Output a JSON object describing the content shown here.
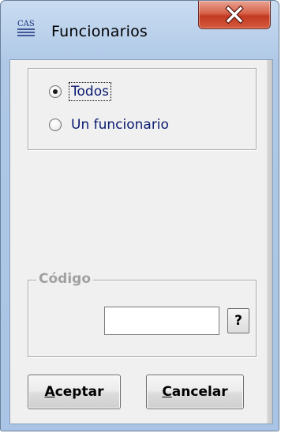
{
  "window": {
    "title": "Funcionarios",
    "app_icon_text": "CAS"
  },
  "options": {
    "todos_label": "Todos",
    "un_funcionario_label": "Un funcionario",
    "selected": "Todos"
  },
  "codigo": {
    "legend": "Código",
    "value": "",
    "help_label": "?"
  },
  "buttons": {
    "aceptar_mnemonic": "A",
    "aceptar_rest": "ceptar",
    "cancelar_mnemonic": "C",
    "cancelar_rest": "ancelar"
  },
  "colors": {
    "label_text": "#0a1a70",
    "disabled_text": "#a0a0a0",
    "dialog_bg": "#f0f0f0",
    "close_button": "#c23a22"
  },
  "icons": {
    "app": "cas-app-icon",
    "close": "close-icon"
  }
}
